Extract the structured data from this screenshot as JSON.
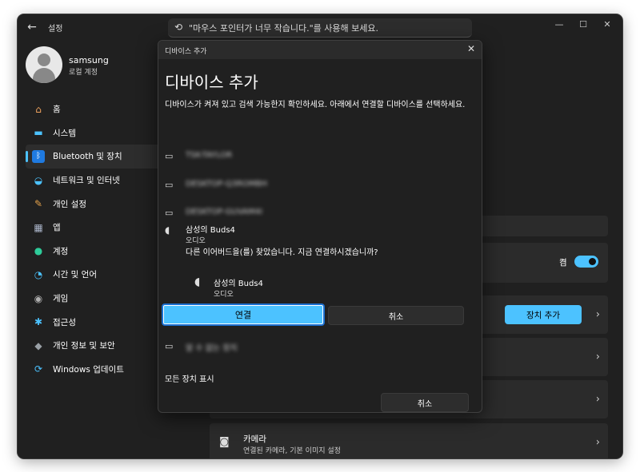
{
  "window": {
    "back_glyph": "←",
    "app_title": "설정",
    "search_placeholder": "\"마우스 포인터가 너무 작습니다.\"를 사용해 보세요.",
    "controls": {
      "minimize": "—",
      "maximize": "☐",
      "close": "✕"
    }
  },
  "profile": {
    "name": "samsung",
    "account_type": "로컬 계정"
  },
  "sidebar": {
    "items": [
      {
        "label": "홈",
        "icon": "home-icon",
        "glyph": "⌂",
        "color": "#f0a35e"
      },
      {
        "label": "시스템",
        "icon": "monitor-icon",
        "glyph": "▬",
        "color": "#4cc2ff"
      },
      {
        "label": "Bluetooth 및 장치",
        "icon": "bluetooth-icon",
        "glyph": "ᛒ",
        "color": "#1f7ae0",
        "active": true
      },
      {
        "label": "네트워크 및 인터넷",
        "icon": "wifi-icon",
        "glyph": "◒",
        "color": "#4cc2ff"
      },
      {
        "label": "개인 설정",
        "icon": "brush-icon",
        "glyph": "✎",
        "color": "#e6a34c"
      },
      {
        "label": "앱",
        "icon": "apps-icon",
        "glyph": "▦",
        "color": "#aab4c8"
      },
      {
        "label": "계정",
        "icon": "person-icon",
        "glyph": "●",
        "color": "#2ecc9a"
      },
      {
        "label": "시간 및 언어",
        "icon": "globe-clock-icon",
        "glyph": "◔",
        "color": "#4cc2ff"
      },
      {
        "label": "게임",
        "icon": "gamepad-icon",
        "glyph": "◉",
        "color": "#b0b0b0"
      },
      {
        "label": "접근성",
        "icon": "accessibility-icon",
        "glyph": "✱",
        "color": "#4cc2ff"
      },
      {
        "label": "개인 정보 및 보안",
        "icon": "shield-icon",
        "glyph": "◆",
        "color": "#9aa0a6"
      },
      {
        "label": "Windows 업데이트",
        "icon": "update-icon",
        "glyph": "⟳",
        "color": "#4cc2ff"
      }
    ]
  },
  "content": {
    "bluetooth_toggle_label": "켬",
    "add_device_button": "장치 추가",
    "camera_title": "카메라",
    "camera_subtitle": "연결된 카메라, 기본 이미지 설정",
    "chevron": "›"
  },
  "dialog": {
    "bar_title": "디바이스 추가",
    "close_glyph": "✕",
    "heading": "디바이스 추가",
    "description": "디바이스가 켜져 있고 검색 가능한지 확인하세요. 아래에서 연결할 디바이스를 선택하세요.",
    "devices": [
      {
        "name": "TSK-TAYLOR",
        "icon": "computer-icon"
      },
      {
        "name": "DESKTOP-Q3ROMBH",
        "icon": "computer-icon"
      },
      {
        "name": "DESKTOP-GUVAM4I",
        "icon": "computer-icon"
      }
    ],
    "buds": {
      "name": "삼성의 Buds4",
      "type": "오디오",
      "message": "다른 이어버드을(를) 찾았습니다. 지금 연결하시겠습니까?",
      "sub_name": "삼성의 Buds4",
      "sub_type": "오디오"
    },
    "connect_button": "연결",
    "cancel_button": "취소",
    "unknown_device": "알 수 없는 장치",
    "show_all": "모든 장치 표시",
    "cancel_footer": "취소"
  }
}
